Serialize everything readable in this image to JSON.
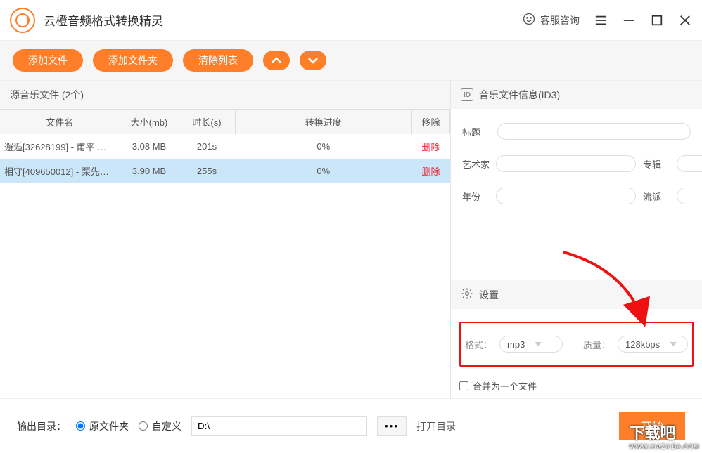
{
  "app": {
    "title": "云橙音频格式转换精灵",
    "customer_service": "客服咨询"
  },
  "toolbar": {
    "add_file": "添加文件",
    "add_folder": "添加文件夹",
    "clear_list": "清除列表"
  },
  "source": {
    "header": "源音乐文件 (2个)",
    "cols": {
      "filename": "文件名",
      "size": "大小(mb)",
      "duration": "时长(s)",
      "progress": "转换进度",
      "remove": "移除"
    },
    "files": [
      {
        "name": "邂逅[32628199] - 甫平 …",
        "size": "3.08 MB",
        "duration": "201s",
        "progress": "0%",
        "remove": "删除",
        "selected": false
      },
      {
        "name": "相守[409650012] - 栗先…",
        "size": "3.90 MB",
        "duration": "255s",
        "progress": "0%",
        "remove": "删除",
        "selected": true
      }
    ]
  },
  "id3": {
    "header": "音乐文件信息(ID3)",
    "id_badge": "ID",
    "labels": {
      "title": "标题",
      "artist": "艺术家",
      "album": "专辑",
      "year": "年份",
      "genre": "流派"
    },
    "values": {
      "title": "",
      "artist": "",
      "album": "",
      "year": "",
      "genre": ""
    }
  },
  "settings": {
    "header": "设置",
    "format_label": "格式：",
    "format_value": "mp3",
    "quality_label": "质量：",
    "quality_value": "128kbps",
    "merge_label": "合并为一个文件"
  },
  "output": {
    "label": "输出目录：",
    "option_original": "原文件夹",
    "option_custom": "自定义",
    "path_value": "D:\\",
    "browse": "●●●",
    "open_dir": "打开目录",
    "start": "开始"
  },
  "watermark": {
    "line1": "下载吧",
    "line2": "WWW.XIAZAIBA.COM"
  }
}
